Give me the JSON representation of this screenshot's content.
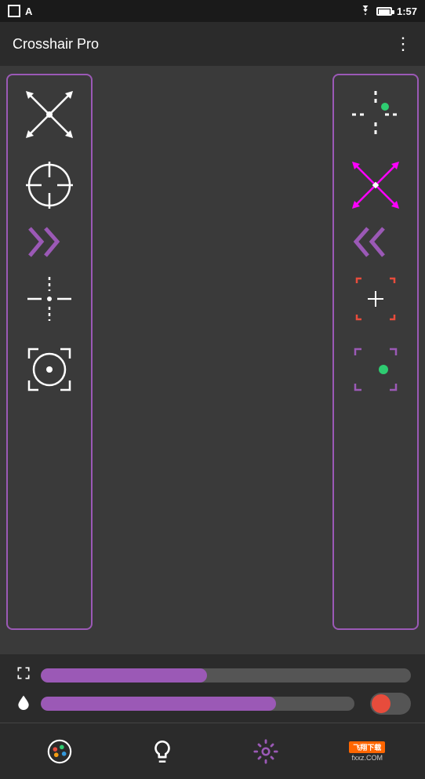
{
  "statusBar": {
    "time": "1:57",
    "batteryLabel": "battery"
  },
  "appBar": {
    "title": "Crosshair Pro",
    "moreIconLabel": "more-options"
  },
  "leftPanel": {
    "crosshairs": [
      {
        "id": "x-crosshair",
        "type": "x-style"
      },
      {
        "id": "circle-crosshair",
        "type": "circle-style"
      },
      {
        "id": "chevron-right",
        "type": "chevron"
      },
      {
        "id": "dot-crosshair",
        "type": "dot-style"
      },
      {
        "id": "target-crosshair",
        "type": "target-style"
      }
    ]
  },
  "rightPanel": {
    "crosshairs": [
      {
        "id": "dot-top-crosshair",
        "type": "dot-top"
      },
      {
        "id": "magenta-x-crosshair",
        "type": "magenta-x"
      },
      {
        "id": "chevron-left",
        "type": "chevron-left"
      },
      {
        "id": "red-bracket-crosshair",
        "type": "red-bracket"
      },
      {
        "id": "purple-bracket-crosshair",
        "type": "purple-bracket"
      }
    ]
  },
  "controls": {
    "slider1": {
      "icon": "expand",
      "value": 45,
      "max": 100
    },
    "slider2": {
      "icon": "droplet",
      "value": 75,
      "max": 100
    },
    "toggle": {
      "active": false
    }
  },
  "bottomNav": {
    "items": [
      {
        "id": "palette",
        "label": "palette-icon"
      },
      {
        "id": "bulb",
        "label": "bulb-icon"
      },
      {
        "id": "settings",
        "label": "settings-icon"
      }
    ]
  },
  "watermark": {
    "brand": "飞翔下载",
    "domain": "fxxz.com",
    "label": "COM"
  }
}
